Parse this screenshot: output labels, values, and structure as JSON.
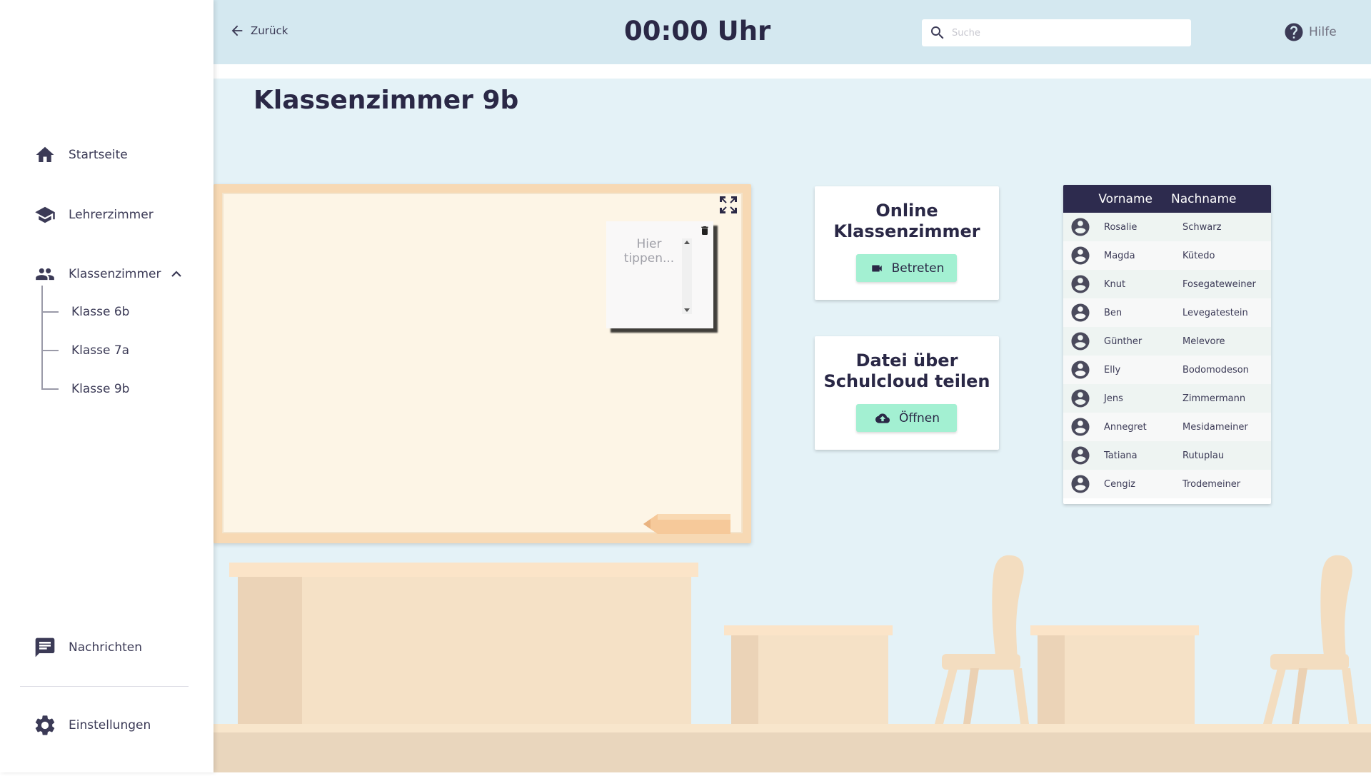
{
  "sidebar": {
    "items": [
      {
        "label": "Startseite",
        "icon": "home-icon"
      },
      {
        "label": "Lehrerzimmer",
        "icon": "graduation-cap-icon"
      },
      {
        "label": "Klassenzimmer",
        "icon": "people-icon"
      }
    ],
    "subitems": [
      "Klasse 6b",
      "Klasse 7a",
      "Klasse 9b"
    ],
    "bottom": [
      {
        "label": "Nachrichten",
        "icon": "message-icon"
      },
      {
        "label": "Einstellungen",
        "icon": "gear-icon"
      }
    ]
  },
  "topbar": {
    "back_label": "Zurück",
    "clock": "00:00 Uhr",
    "search_placeholder": "Suche",
    "help_label": "Hilfe"
  },
  "main": {
    "title": "Klassenzimmer 9b",
    "note_placeholder": "Hier tippen..."
  },
  "cards": [
    {
      "title_line1": "Online",
      "title_line2": "Klassenzimmer",
      "button": "Betreten",
      "icon": "video-camera-icon"
    },
    {
      "title_line1": "Datei über",
      "title_line2": "Schulcloud teilen",
      "button": "Öffnen",
      "icon": "cloud-upload-icon"
    }
  ],
  "students": {
    "headers": [
      "Vorname",
      "Nachname"
    ],
    "rows": [
      {
        "first": "Rosalie",
        "last": "Schwarz"
      },
      {
        "first": "Magda",
        "last": "Kütedo"
      },
      {
        "first": "Knut",
        "last": "Fosegateweiner"
      },
      {
        "first": "Ben",
        "last": "Levegatestein"
      },
      {
        "first": "Günther",
        "last": "Melevore"
      },
      {
        "first": "Elly",
        "last": "Bodomodeson"
      },
      {
        "first": "Jens",
        "last": "Zimmermann"
      },
      {
        "first": "Annegret",
        "last": "Mesidameiner"
      },
      {
        "first": "Tatiana",
        "last": "Rutuplau"
      },
      {
        "first": "Cengiz",
        "last": "Trodemeiner"
      }
    ]
  },
  "colors": {
    "accent_dark": "#2d2b4e",
    "topbar_bg": "#d4e8f0",
    "main_bg": "#e4f2f7",
    "button_bg": "#a3f0d2"
  }
}
